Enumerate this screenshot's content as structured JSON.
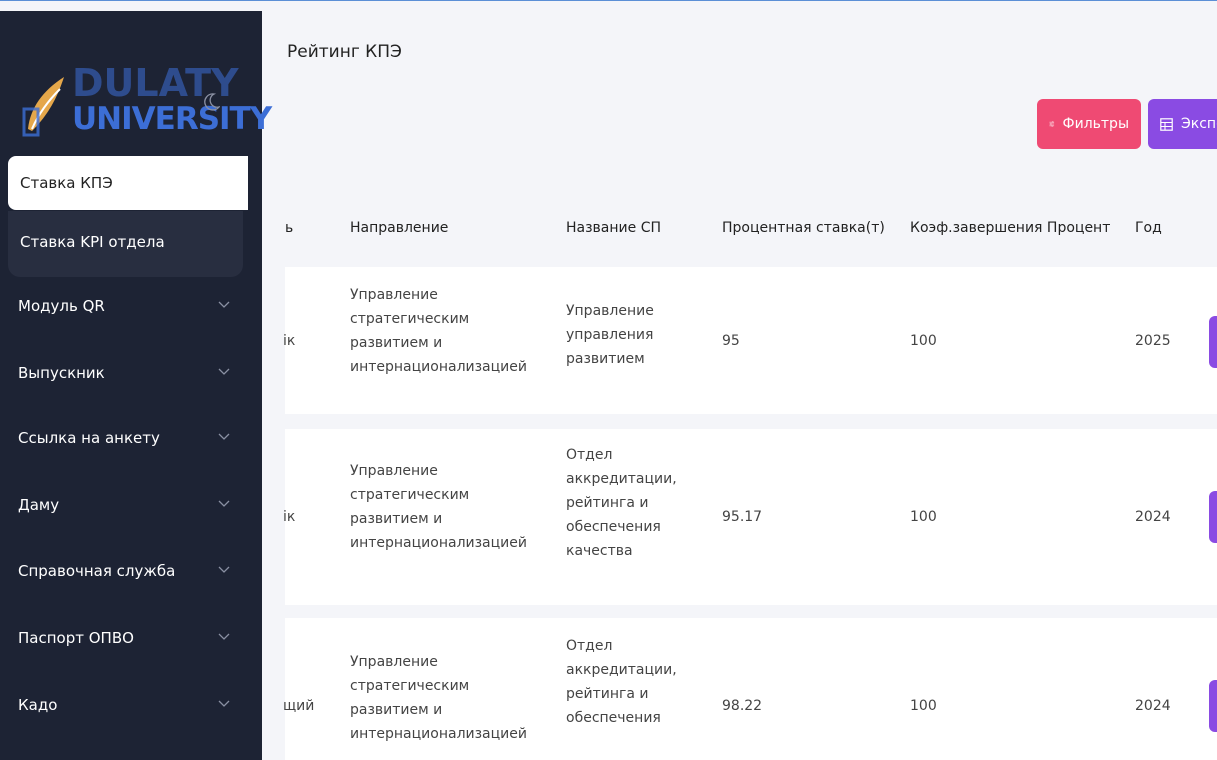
{
  "brand": {
    "line1": "DULATY",
    "line2": "UNIVERSITY"
  },
  "sidebar": {
    "active_item": "Ставка КПЭ",
    "sub_item": "Ставка KPI отдела",
    "items": [
      {
        "label": "Модуль QR"
      },
      {
        "label": "Выпускник"
      },
      {
        "label": "Ссылка на анкету"
      },
      {
        "label": "Даму"
      },
      {
        "label": "Справочная служба"
      },
      {
        "label": "Паспорт ОПВО"
      },
      {
        "label": "Кадо"
      }
    ]
  },
  "page": {
    "title": "Рейтинг КПЭ"
  },
  "toolbar": {
    "filters_label": "Фильтры",
    "export_label": "Экспо"
  },
  "table": {
    "headers": {
      "position_partial": "ь",
      "direction": "Направление",
      "unit_name": "Название СП",
      "rate": "Процентная ставка(т)",
      "completion": "Коэф.завершения Процент",
      "year": "Год"
    },
    "rows": [
      {
        "position_partial": "ік",
        "direction": [
          "Управление",
          "стратегическим",
          "развитием и",
          "интернационализацией"
        ],
        "unit_name": [
          "Управление",
          "управления",
          "развитием"
        ],
        "rate": "95",
        "completion": "100",
        "year": "2025"
      },
      {
        "position_partial": "ік",
        "direction": [
          "Управление",
          "стратегическим",
          "развитием и",
          "интернационализацией"
        ],
        "unit_name": [
          "Отдел",
          "аккредитации,",
          "рейтинга и",
          "обеспечения",
          "качества"
        ],
        "rate": "95.17",
        "completion": "100",
        "year": "2024"
      },
      {
        "position_partial": "щий",
        "direction": [
          "Управление",
          "стратегическим",
          "развитием и",
          "интернационализацией"
        ],
        "unit_name": [
          "Отдел",
          "аккредитации,",
          "рейтинга и",
          "обеспечения"
        ],
        "rate": "98.22",
        "completion": "100",
        "year": "2024"
      }
    ]
  },
  "colors": {
    "sidebar_bg": "#1d2334",
    "filter_btn": "#ef4a73",
    "export_btn": "#8a4be3",
    "brand_blue": "#3c6ed6"
  }
}
